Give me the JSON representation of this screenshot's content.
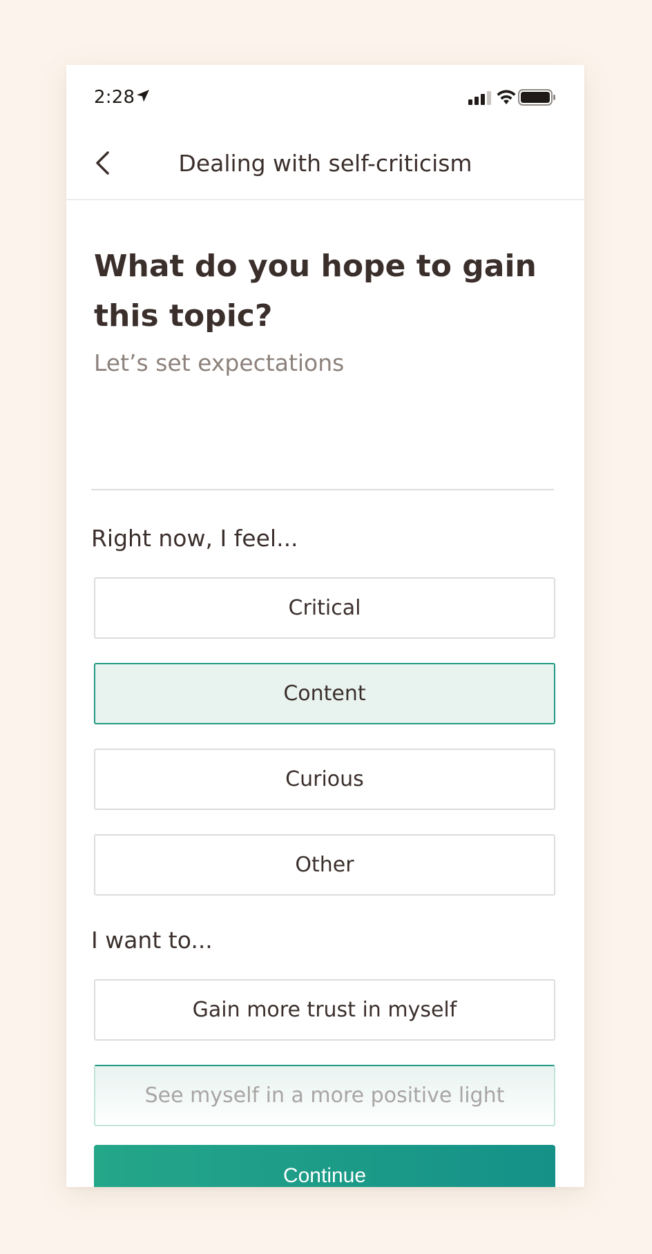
{
  "status_bar": {
    "time": "2:28"
  },
  "nav": {
    "title": "Dealing with self-criticism"
  },
  "question": {
    "title": "What do you hope to gain this topic?",
    "subtitle": "Let’s set expectations"
  },
  "feel_section": {
    "label": "Right now, I feel...",
    "options": [
      {
        "label": "Critical",
        "selected": false
      },
      {
        "label": "Content",
        "selected": true
      },
      {
        "label": "Curious",
        "selected": false
      },
      {
        "label": "Other",
        "selected": false
      }
    ]
  },
  "want_section": {
    "label": "I want to...",
    "options": [
      {
        "label": "Gain more trust in myself",
        "selected": false
      },
      {
        "label": "See myself in a more positive light",
        "selected": true
      }
    ]
  },
  "continue_label": "Continue",
  "colors": {
    "page_background": "#fcf4ec",
    "accent": "#1f9982",
    "selected_fill": "#e8f3f0",
    "text_primary": "#3b2f2c",
    "text_secondary": "#8c817b"
  }
}
